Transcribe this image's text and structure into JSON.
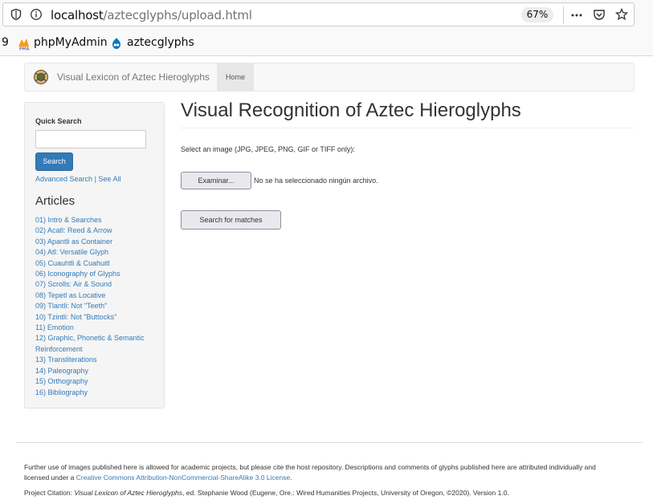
{
  "browser": {
    "url_host": "localhost",
    "url_path": "/aztecglyphs/upload.html",
    "zoom": "67%",
    "bookmarks": {
      "partial": "9",
      "phpmyadmin": "phpMyAdmin",
      "aztecglyphs": "aztecglyphs"
    },
    "icons": [
      "shield-icon",
      "info-icon",
      "more-icon",
      "pocket-icon",
      "star-icon",
      "pma-icon",
      "drupal-icon"
    ]
  },
  "navbar": {
    "brand": "Visual Lexicon of Aztec Hieroglyphs",
    "home": "Home"
  },
  "sidebar": {
    "quick_search_label": "Quick Search",
    "search_button": "Search",
    "advanced_search": "Advanced Search",
    "separator": "|",
    "see_all": "See All",
    "articles_title": "Articles",
    "articles": [
      "01) Intro & Searches",
      "02) Acatl: Reed & Arrow",
      "03) Apantli as Container",
      "04) Atl: Versatile Glyph",
      "05) Cuauhtli & Cuahuitl",
      "06) Iconography of Glyphs",
      "07) Scrolls: Air & Sound",
      "08) Tepetl as Locative",
      "09) Tlantli: Not \"Teeth\"",
      "10) Tzintli: Not \"Buttocks\"",
      "11) Emotion",
      "12) Graphic, Phonetic & Semantic Reinforcement",
      "13) Transliterations",
      "14) Paleography",
      "15) Orthography",
      "16) Bibliography"
    ]
  },
  "main": {
    "title": "Visual Recognition of Aztec Hieroglyphs",
    "select_label": "Select an image (JPG, JPEG, PNG, GIF or TIFF only):",
    "file_button": "Examinar...",
    "file_status": "No se ha seleccionado ningún archivo.",
    "search_matches_button": "Search for matches"
  },
  "footer": {
    "text1": "Further use of images published here is allowed for academic projects, but please cite the host repository. Descriptions and comments of glyphs published here are attributed individually and licensed under a ",
    "license_link": "Creative Commons Attribution-NonCommercial-ShareAlike 3.0 License",
    "text1_end": ".",
    "citation_prefix": "Project Citation: ",
    "citation_title": "Visual Lexicon of Aztec Hieroglyphs",
    "citation_rest": ", ed. Stephanie Wood (Eugene, Ore.: Wired Humanities Projects, University of Oregon, ©2020). Version 1.0."
  }
}
